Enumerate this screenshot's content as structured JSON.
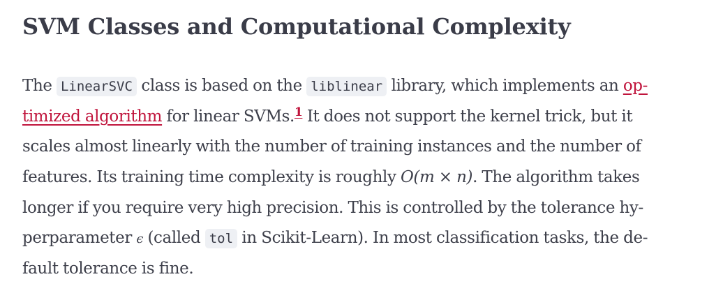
{
  "heading": "SVM Classes and Computational Complexity",
  "paragraph": {
    "l1_t1": "The ",
    "code_linearsvc": "LinearSVC",
    "l1_t2": " class is based on the ",
    "code_liblinear": "liblinear",
    "l1_t3": " library, which implements an ",
    "link_part1": "op-",
    "link_part2": "timized algorithm",
    "l2_t1": " for linear SVMs.",
    "footnote": "1",
    "l2_t2": " It does not support the kernel trick, but it",
    "l3": "scales almost linearly with the number of training instances and the number of",
    "l4_t1": "features. Its training time complexity is roughly ",
    "l4_math": "O(m × n)",
    "l4_t2": ". The algorithm takes",
    "l5": "longer if you require very high precision. This is controlled by the tolerance hy-",
    "l6_t1": "perparameter ",
    "l6_eps": "ϵ",
    "l6_t2": " (called ",
    "code_tol": "tol",
    "l6_t3": " in Scikit-Learn). In most classification tasks, the de-",
    "l7": "fault tolerance is fine."
  }
}
